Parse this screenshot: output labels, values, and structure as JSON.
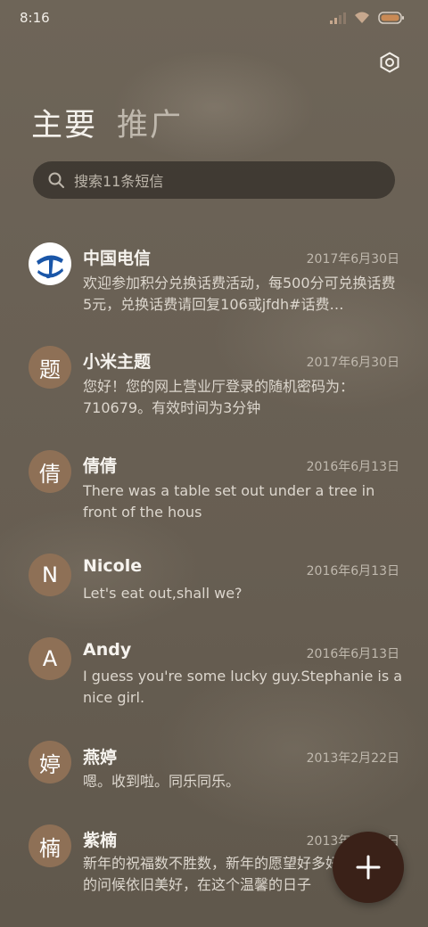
{
  "status_bar": {
    "time": "8:16"
  },
  "tabs": [
    {
      "label": "主要",
      "active": true
    },
    {
      "label": "推广",
      "active": false
    }
  ],
  "search": {
    "placeholder": "搜索11条短信"
  },
  "conversations": [
    {
      "avatar": "",
      "avatar_kind": "china-telecom-logo",
      "name": "中国电信",
      "date": "2017年6月30日",
      "preview": "欢迎参加积分兑换话费活动，每500分可兑换话费5元，兑换话费请回复106或jfdh#话费…"
    },
    {
      "avatar": "题",
      "name": "小米主题",
      "date": "2017年6月30日",
      "preview": "您好！您的网上营业厅登录的随机密码为：710679。有效时间为3分钟"
    },
    {
      "avatar": "倩",
      "name": "倩倩",
      "date": "2016年6月13日",
      "preview": "There was a table set out under a tree in front of the hous"
    },
    {
      "avatar": "N",
      "name": "Nicole",
      "date": "2016年6月13日",
      "preview": "Let's eat out,shall we?"
    },
    {
      "avatar": "A",
      "name": "Andy",
      "date": "2016年6月13日",
      "preview": "I guess you're some lucky guy.Stephanie is a nice girl."
    },
    {
      "avatar": "婷",
      "name": "燕婷",
      "date": "2013年2月22日",
      "preview": "嗯。收到啦。同乐同乐。"
    },
    {
      "avatar": "楠",
      "name": "紫楠",
      "date": "2013年2月22日",
      "preview": "新年的祝福数不胜数，新年的愿望好多好多，新年的问候依旧美好，在这个温馨的日子"
    }
  ],
  "icons": {
    "settings": "settings-icon",
    "search": "search-icon",
    "compose": "plus-icon"
  },
  "colors": {
    "fab": "#3a2118",
    "avatar": "#8e7056"
  }
}
